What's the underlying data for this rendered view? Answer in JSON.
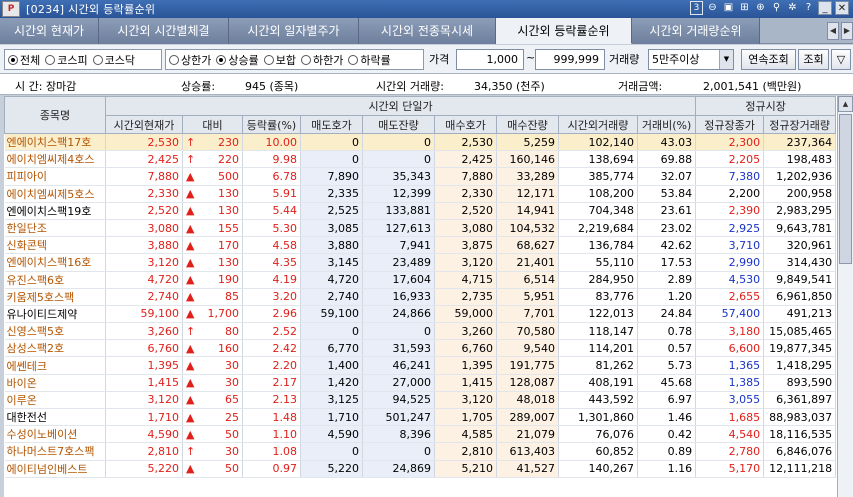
{
  "window": {
    "logo": "P",
    "title": "[0234] 시간외 등락률순위",
    "page_indicator": "3"
  },
  "tabs": [
    {
      "label": "시간외 현재가",
      "w": 99
    },
    {
      "label": "시간외 시간별체결",
      "w": 130
    },
    {
      "label": "시간외 일자별주가",
      "w": 130
    },
    {
      "label": "시간외 전종목시세",
      "w": 137
    },
    {
      "label": "시간외 등락률순위",
      "w": 136
    },
    {
      "label": "시간외 거래량순위",
      "w": 128
    }
  ],
  "filters": {
    "market_options": [
      "전체",
      "코스피",
      "코스닥"
    ],
    "market_selected": "전체",
    "direction_options": [
      "상한가",
      "상승률",
      "보합",
      "하한가",
      "하락률"
    ],
    "direction_selected": "상승률",
    "price_label": "가격",
    "price_min": "1,000",
    "price_sep": "~",
    "price_max": "999,999",
    "volume_label": "거래량",
    "volume_value": "5만주이상",
    "continuous_button": "연속조회",
    "search_button": "조회",
    "filter_icon": "funnel-icon"
  },
  "summary": {
    "time_label": "시  간: 장마감",
    "rise_rate_label": "상승률:",
    "rise_rate_value": "945 (종목)",
    "volume_label": "시간외 거래량:",
    "volume_value": "34,350 (천주)",
    "amount_label": "거래금액:",
    "amount_value": "2,001,541 (백만원)"
  },
  "table": {
    "group_headers": {
      "name": "종목명",
      "overtime": "시간외 단일가",
      "regular": "정규시장"
    },
    "columns": [
      "시간외현재가",
      "대비",
      "등락률(%)",
      "매도호가",
      "매도잔량",
      "매수호가",
      "매수잔량",
      "시간외거래량",
      "거래비(%)",
      "정규장종가",
      "정규장거래량"
    ],
    "rows": [
      {
        "name": "엔에이치스팩17호",
        "nc": "orange",
        "price": "2,530",
        "arrow": "↑",
        "diff": "230",
        "rate": "10.00",
        "ask": "0",
        "ask_qty": "0",
        "bid": "2,530",
        "bid_qty": "5,259",
        "vol": "102,140",
        "ratio": "43.03",
        "close": "2,300",
        "cc": "up",
        "reg_vol": "237,364",
        "sel": true
      },
      {
        "name": "에이치엠씨제4호스",
        "nc": "orange",
        "price": "2,425",
        "arrow": "↑",
        "diff": "220",
        "rate": "9.98",
        "ask": "0",
        "ask_qty": "0",
        "bid": "2,425",
        "bid_qty": "160,146",
        "vol": "138,694",
        "ratio": "69.88",
        "close": "2,205",
        "cc": "up",
        "reg_vol": "198,483"
      },
      {
        "name": "피피아이",
        "nc": "orange",
        "price": "7,880",
        "arrow": "▲",
        "diff": "500",
        "rate": "6.78",
        "ask": "7,890",
        "ask_qty": "35,343",
        "bid": "7,880",
        "bid_qty": "33,289",
        "vol": "385,774",
        "ratio": "32.07",
        "close": "7,380",
        "cc": "dn",
        "reg_vol": "1,202,936"
      },
      {
        "name": "에이치엠씨제5호스",
        "nc": "orange",
        "price": "2,330",
        "arrow": "▲",
        "diff": "130",
        "rate": "5.91",
        "ask": "2,335",
        "ask_qty": "12,399",
        "bid": "2,330",
        "bid_qty": "12,171",
        "vol": "108,200",
        "ratio": "53.84",
        "close": "2,200",
        "cc": "",
        "reg_vol": "200,958"
      },
      {
        "name": "엔에이치스팩19호",
        "nc": "black",
        "price": "2,520",
        "arrow": "▲",
        "diff": "130",
        "rate": "5.44",
        "ask": "2,525",
        "ask_qty": "133,881",
        "bid": "2,520",
        "bid_qty": "14,941",
        "vol": "704,348",
        "ratio": "23.61",
        "close": "2,390",
        "cc": "up",
        "reg_vol": "2,983,295"
      },
      {
        "name": "한일단조",
        "nc": "orange",
        "price": "3,080",
        "arrow": "▲",
        "diff": "155",
        "rate": "5.30",
        "ask": "3,085",
        "ask_qty": "127,613",
        "bid": "3,080",
        "bid_qty": "104,532",
        "vol": "2,219,684",
        "ratio": "23.02",
        "close": "2,925",
        "cc": "dn",
        "reg_vol": "9,643,781"
      },
      {
        "name": "신화콘텍",
        "nc": "orange",
        "price": "3,880",
        "arrow": "▲",
        "diff": "170",
        "rate": "4.58",
        "ask": "3,880",
        "ask_qty": "7,941",
        "bid": "3,875",
        "bid_qty": "68,627",
        "vol": "136,784",
        "ratio": "42.62",
        "close": "3,710",
        "cc": "dn",
        "reg_vol": "320,961"
      },
      {
        "name": "엔에이치스팩16호",
        "nc": "orange",
        "price": "3,120",
        "arrow": "▲",
        "diff": "130",
        "rate": "4.35",
        "ask": "3,145",
        "ask_qty": "23,489",
        "bid": "3,120",
        "bid_qty": "21,401",
        "vol": "55,110",
        "ratio": "17.53",
        "close": "2,990",
        "cc": "dn",
        "reg_vol": "314,430"
      },
      {
        "name": "유진스팩6호",
        "nc": "orange",
        "price": "4,720",
        "arrow": "▲",
        "diff": "190",
        "rate": "4.19",
        "ask": "4,720",
        "ask_qty": "17,604",
        "bid": "4,715",
        "bid_qty": "6,514",
        "vol": "284,950",
        "ratio": "2.89",
        "close": "4,530",
        "cc": "dn",
        "reg_vol": "9,849,541"
      },
      {
        "name": "키움제5호스팩",
        "nc": "orange",
        "price": "2,740",
        "arrow": "▲",
        "diff": "85",
        "rate": "3.20",
        "ask": "2,740",
        "ask_qty": "16,933",
        "bid": "2,735",
        "bid_qty": "5,951",
        "vol": "83,776",
        "ratio": "1.20",
        "close": "2,655",
        "cc": "up",
        "reg_vol": "6,961,850"
      },
      {
        "name": "유나이티드제약",
        "nc": "black",
        "price": "59,100",
        "arrow": "▲",
        "diff": "1,700",
        "rate": "2.96",
        "ask": "59,100",
        "ask_qty": "24,866",
        "bid": "59,000",
        "bid_qty": "7,701",
        "vol": "122,013",
        "ratio": "24.84",
        "close": "57,400",
        "cc": "dn",
        "reg_vol": "491,213"
      },
      {
        "name": "신영스팩5호",
        "nc": "orange",
        "price": "3,260",
        "arrow": "↑",
        "diff": "80",
        "rate": "2.52",
        "ask": "0",
        "ask_qty": "0",
        "bid": "3,260",
        "bid_qty": "70,580",
        "vol": "118,147",
        "ratio": "0.78",
        "close": "3,180",
        "cc": "up",
        "reg_vol": "15,085,465"
      },
      {
        "name": "삼성스팩2호",
        "nc": "orange",
        "price": "6,760",
        "arrow": "▲",
        "diff": "160",
        "rate": "2.42",
        "ask": "6,770",
        "ask_qty": "31,593",
        "bid": "6,760",
        "bid_qty": "9,540",
        "vol": "114,201",
        "ratio": "0.57",
        "close": "6,600",
        "cc": "up",
        "reg_vol": "19,877,345"
      },
      {
        "name": "에쎈테크",
        "nc": "orange",
        "price": "1,395",
        "arrow": "▲",
        "diff": "30",
        "rate": "2.20",
        "ask": "1,400",
        "ask_qty": "46,241",
        "bid": "1,395",
        "bid_qty": "191,775",
        "vol": "81,262",
        "ratio": "5.73",
        "close": "1,365",
        "cc": "dn",
        "reg_vol": "1,418,295"
      },
      {
        "name": "바이온",
        "nc": "orange",
        "price": "1,415",
        "arrow": "▲",
        "diff": "30",
        "rate": "2.17",
        "ask": "1,420",
        "ask_qty": "27,000",
        "bid": "1,415",
        "bid_qty": "128,087",
        "vol": "408,191",
        "ratio": "45.68",
        "close": "1,385",
        "cc": "dn",
        "reg_vol": "893,590"
      },
      {
        "name": "이루온",
        "nc": "orange",
        "price": "3,120",
        "arrow": "▲",
        "diff": "65",
        "rate": "2.13",
        "ask": "3,125",
        "ask_qty": "94,525",
        "bid": "3,120",
        "bid_qty": "48,018",
        "vol": "443,592",
        "ratio": "6.97",
        "close": "3,055",
        "cc": "dn",
        "reg_vol": "6,361,897"
      },
      {
        "name": "대한전선",
        "nc": "black",
        "price": "1,710",
        "arrow": "▲",
        "diff": "25",
        "rate": "1.48",
        "ask": "1,710",
        "ask_qty": "501,247",
        "bid": "1,705",
        "bid_qty": "289,007",
        "vol": "1,301,860",
        "ratio": "1.46",
        "close": "1,685",
        "cc": "up",
        "reg_vol": "88,983,037"
      },
      {
        "name": "수성이노베이션",
        "nc": "orange",
        "price": "4,590",
        "arrow": "▲",
        "diff": "50",
        "rate": "1.10",
        "ask": "4,590",
        "ask_qty": "8,396",
        "bid": "4,585",
        "bid_qty": "21,079",
        "vol": "76,076",
        "ratio": "0.42",
        "close": "4,540",
        "cc": "up",
        "reg_vol": "18,116,535"
      },
      {
        "name": "하나머스트7호스팩",
        "nc": "orange",
        "price": "2,810",
        "arrow": "↑",
        "diff": "30",
        "rate": "1.08",
        "ask": "0",
        "ask_qty": "0",
        "bid": "2,810",
        "bid_qty": "613,403",
        "vol": "60,852",
        "ratio": "0.89",
        "close": "2,780",
        "cc": "up",
        "reg_vol": "6,846,076"
      },
      {
        "name": "에이티넘인베스트",
        "nc": "orange",
        "price": "5,220",
        "arrow": "▲",
        "diff": "50",
        "rate": "0.97",
        "ask": "5,220",
        "ask_qty": "24,869",
        "bid": "5,210",
        "bid_qty": "41,527",
        "vol": "140,267",
        "ratio": "1.16",
        "close": "5,170",
        "cc": "up",
        "reg_vol": "12,111,218"
      }
    ]
  },
  "colors": {
    "up": "#e0201b",
    "down": "#1a33c8",
    "selected_row": "#fbeecb",
    "title_bar": "#2a5497"
  }
}
